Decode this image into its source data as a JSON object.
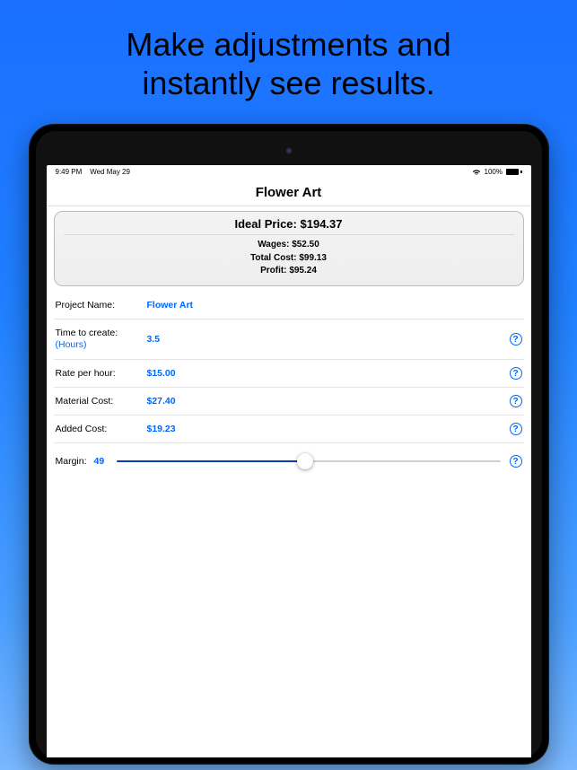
{
  "promo": {
    "line1": "Make adjustments and",
    "line2": "instantly see results."
  },
  "statusbar": {
    "time": "9:49 PM",
    "date": "Wed May 29",
    "battery_pct": "100%"
  },
  "app": {
    "title": "Flower Art"
  },
  "summary": {
    "ideal_label": "Ideal Price:",
    "ideal_value": "$194.37",
    "wages_label": "Wages:",
    "wages_value": "$52.50",
    "total_cost_label": "Total Cost:",
    "total_cost_value": "$99.13",
    "profit_label": "Profit:",
    "profit_value": "$95.24"
  },
  "fields": {
    "project_name": {
      "label": "Project Name:",
      "value": "Flower Art"
    },
    "time_to_create": {
      "label": "Time to create:",
      "unit": "(Hours)",
      "value": "3.5"
    },
    "rate_per_hour": {
      "label": "Rate per hour:",
      "value": "$15.00"
    },
    "material_cost": {
      "label": "Material Cost:",
      "value": "$27.40"
    },
    "added_cost": {
      "label": "Added Cost:",
      "value": "$19.23"
    },
    "margin": {
      "label": "Margin:",
      "value": "49"
    }
  },
  "icons": {
    "help": "?"
  }
}
